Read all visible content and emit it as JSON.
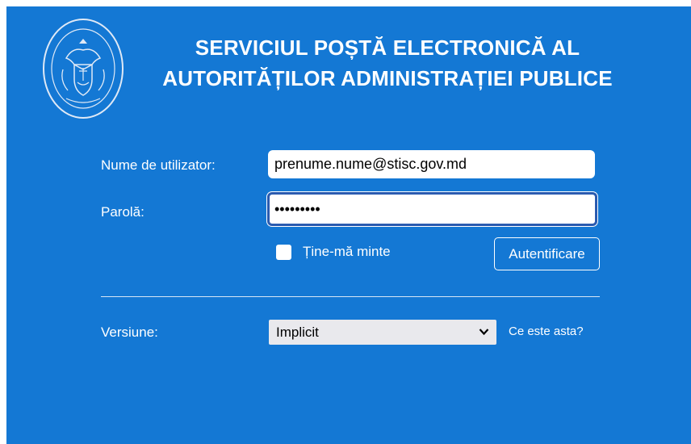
{
  "header": {
    "title_line1": "SERVICIUL POȘTĂ ELECTRONICĂ AL",
    "title_line2": "AUTORITĂȚILOR ADMINISTRAȚIEI PUBLICE",
    "seal_icon": "moldova-coat-of-arms-seal-icon"
  },
  "form": {
    "username_label": "Nume de utilizator:",
    "username_value": "prenume.nume@stisc.gov.md",
    "password_label": "Parolă:",
    "password_value": "•••••••••",
    "remember_label": "Ține-mă minte",
    "remember_checked": false,
    "login_button": "Autentificare"
  },
  "version": {
    "label": "Versiune:",
    "selected": "Implicit",
    "help_link": "Ce este asta?"
  },
  "colors": {
    "panel_bg": "#1478d4",
    "focus_border": "#2a5bb0"
  }
}
